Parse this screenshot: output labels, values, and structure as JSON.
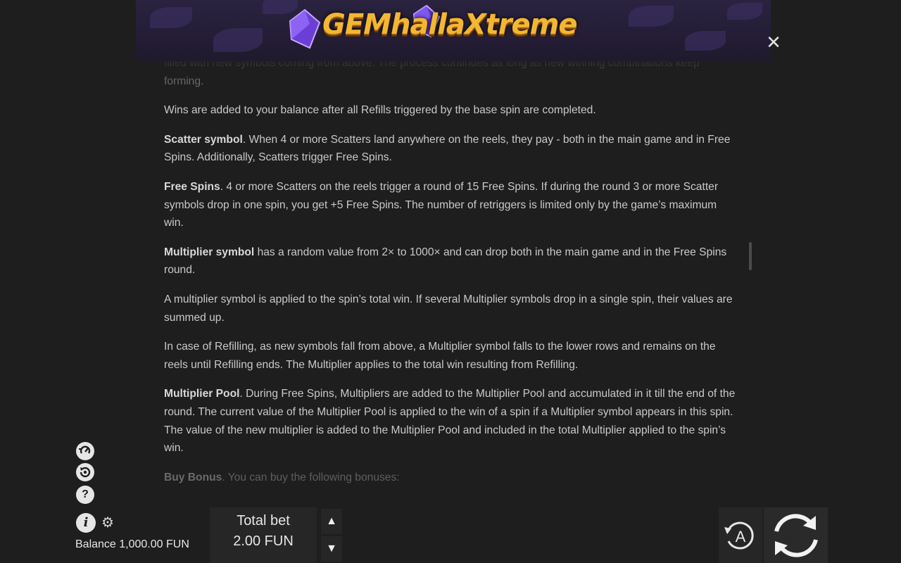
{
  "header": {
    "logo_text": "GEMhallaXtreme"
  },
  "content": {
    "p0": "filled with new symbols coming from above. The process continues as long as new winning combinations keep forming.",
    "p1": "Wins are added to your balance after all Refills triggered by the base spin are completed.",
    "p2_title": "Scatter symbol",
    "p2_text": ". When 4 or more Scatters land anywhere on the reels, they pay - both in the main game and in Free Spins. Additionally, Scatters trigger Free Spins.",
    "p3_title": "Free Spins",
    "p3_text": ". 4 or more Scatters on the reels trigger a round of 15 Free Spins. If during the round 3 or more Scatter symbols drop in one spin, you get +5 Free Spins. The number of retriggers is limited only by the game’s maximum win.",
    "p4_title": "Multiplier symbol",
    "p4_text": " has a random value from 2× to 1000× and can drop both in the main game and in the Free Spins round.",
    "p5": "A multiplier symbol is applied to the spin’s total win. If several Multiplier symbols drop in a single spin, their values are summed up.",
    "p6": "In case of Refilling, as new symbols fall from above, a Multiplier symbol falls to the lower rows and remains on the reels until Refilling ends. The Multiplier applies to the total win resulting from Refilling.",
    "p7_title": "Multiplier Pool",
    "p7_text": ". During Free Spins, Multipliers are added to the Multiplier Pool and accumulated in it till the end of the round. The current value of the Multiplier Pool is applied to the win of a spin if a Multiplier symbol appears in this spin. The value of the new multiplier is added to the Multiplier Pool and included in the total Multiplier applied to the spin’s win.",
    "p8_title": "Buy Bonus",
    "p8_text": ". You can buy the following bonuses:"
  },
  "footer": {
    "balance_label": "Balance 1,000.00 FUN",
    "total_bet_label": "Total bet",
    "total_bet_value": "2.00 FUN",
    "auto_label": "A"
  },
  "icons": {
    "turbo": "turbo-icon",
    "history": "history-icon",
    "help": "help-icon",
    "info": "info-icon",
    "settings": "gear-icon",
    "close": "close-icon",
    "bet_up": "triangle-up-icon",
    "bet_down": "triangle-down-icon",
    "autoplay": "autoplay-icon",
    "spin": "spin-icon"
  },
  "colors": {
    "background": "#1e1e1f",
    "text": "#c9c9c9",
    "panel": "#262627",
    "logo_gold": "#f2b733",
    "header_purple": "#2a2340"
  }
}
